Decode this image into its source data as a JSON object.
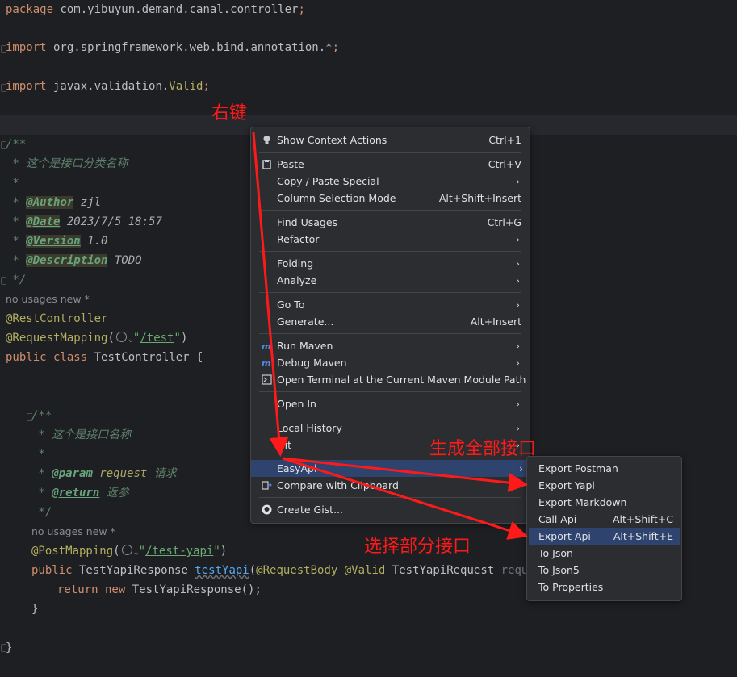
{
  "code": {
    "package_kw": "package",
    "package_name": " com.yibuyun.demand.canal.controller",
    "import_kw": "import",
    "import1": " org.springframework.web.bind.annotation.*",
    "import2_a": " javax.validation.",
    "import2_b": "Valid",
    "semicolon": ";",
    "doc_open": "/**",
    "doc_desc": " * 这个是接口分类名称",
    "doc_star": " *",
    "doc_star_sp": " * ",
    "author_tag": "@Author",
    "author_val": " zjl",
    "date_tag": "@Date",
    "date_val": " 2023/7/5 18:57",
    "version_tag": "@Version",
    "version_val": " 1.0",
    "description_tag": "@Description",
    "description_val": " TODO",
    "doc_close": " */",
    "usage_hint": "no usages   new *",
    "rest_controller": "@RestController",
    "request_mapping": "@RequestMapping",
    "paren_open": "(",
    "paren_close": ")",
    "quote": "\"",
    "test_path": "/test",
    "public_kw": "public",
    "class_kw": " class",
    "class_decl": " TestController {",
    "method_doc_open": "/**",
    "method_doc_desc": " * 这个是接口名称",
    "method_doc_star": " *",
    "param_tag": "@param",
    "param_name": " request",
    "param_desc": " 请求",
    "return_tag": "@return",
    "return_desc": " 返参",
    "method_doc_close": " */",
    "method_usage_hint": "no usages   new *",
    "post_mapping": "@PostMapping",
    "test_yapi_path": "/test-yapi",
    "return_type": " TestYapiResponse ",
    "method_name": "testYapi",
    "request_body": "@RequestBody",
    "valid_ann": " @Valid",
    "param_type": " TestYapiRequest ",
    "param_var": "request",
    "param_tail": ") {",
    "return_kw": "return",
    "new_kw": " new",
    "return_expr": " TestYapiResponse();",
    "close_brace_inner": "}",
    "close_brace_outer": "}"
  },
  "context_menu": {
    "items": [
      {
        "label": "Show Context Actions",
        "shortcut": "Ctrl+1",
        "icon": "lightbulb-icon"
      },
      {
        "label": "Paste",
        "shortcut": "Ctrl+V",
        "icon": "clipboard-icon"
      },
      {
        "label": "Copy / Paste Special",
        "submenu": true
      },
      {
        "label": "Column Selection Mode",
        "shortcut": "Alt+Shift+Insert"
      },
      {
        "label": "Find Usages",
        "shortcut": "Ctrl+G"
      },
      {
        "label": "Refactor",
        "submenu": true
      },
      {
        "label": "Folding",
        "submenu": true
      },
      {
        "label": "Analyze",
        "submenu": true
      },
      {
        "label": "Go To",
        "submenu": true
      },
      {
        "label": "Generate...",
        "shortcut": "Alt+Insert"
      },
      {
        "label": "Run Maven",
        "submenu": true,
        "icon": "maven-icon"
      },
      {
        "label": "Debug Maven",
        "submenu": true,
        "icon": "maven-icon"
      },
      {
        "label": "Open Terminal at the Current Maven Module Path",
        "icon": "terminal-icon"
      },
      {
        "label": "Open In",
        "submenu": true
      },
      {
        "label": "Local History",
        "submenu": true
      },
      {
        "label": "Git",
        "submenu": true
      },
      {
        "label": "EasyApi",
        "submenu": true
      },
      {
        "label": "Compare with Clipboard",
        "icon": "compare-icon"
      },
      {
        "label": "Create Gist...",
        "icon": "github-icon"
      }
    ],
    "arrow": "›"
  },
  "easyapi_submenu": {
    "items": [
      {
        "label": "Export Postman"
      },
      {
        "label": "Export Yapi"
      },
      {
        "label": "Export Markdown"
      },
      {
        "label": "Call Api",
        "shortcut": "Alt+Shift+C"
      },
      {
        "label": "Export Api",
        "shortcut": "Alt+Shift+E"
      },
      {
        "label": "To Json"
      },
      {
        "label": "To Json5"
      },
      {
        "label": "To Properties"
      }
    ]
  },
  "annotations": {
    "right_click": "右键",
    "generate_all": "生成全部接口",
    "select_some": "选择部分接口",
    "color": "#ff1a1a"
  },
  "colors": {
    "background": "#1e1f22",
    "menu_bg": "#2b2d30",
    "highlight": "#2e436e",
    "keyword": "#cf8e6d",
    "annotation": "#b3ae60",
    "string": "#6aab73",
    "doc": "#5f826b"
  }
}
